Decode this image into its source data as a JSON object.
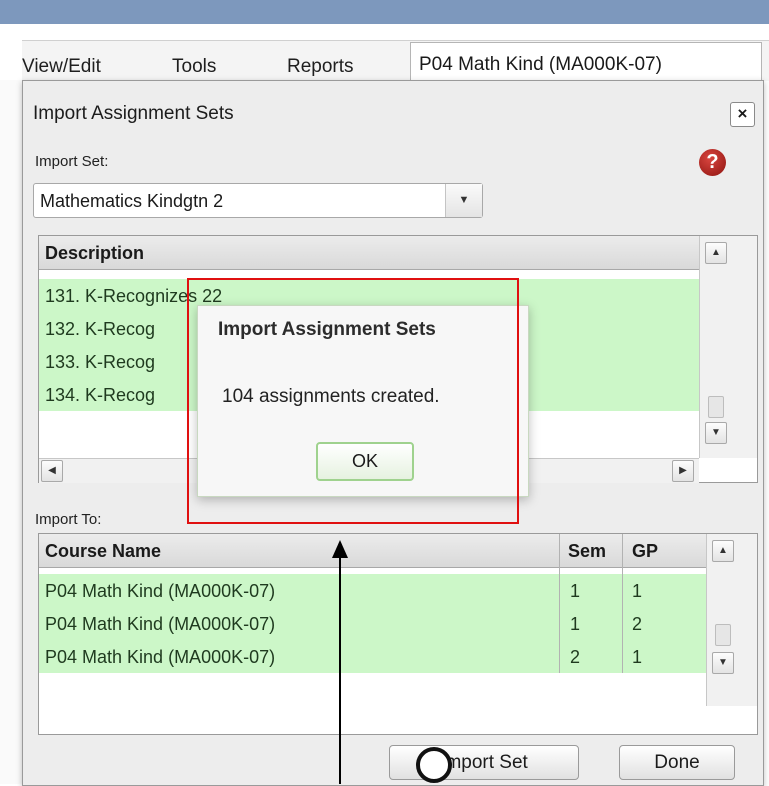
{
  "menubar": {
    "items": [
      "View/Edit",
      "Tools",
      "Reports"
    ],
    "course_tab": "P04   Math Kind (MA000K-07)"
  },
  "dialog": {
    "title": "Import Assignment Sets",
    "close_label": "×",
    "import_set_label": "Import Set:",
    "help_icon": "?",
    "import_set_value": "Mathematics Kindgtn 2",
    "description_header": "Description",
    "descriptions": [
      "131. K-Recognizes 22",
      "132. K-Recog",
      "133. K-Recog",
      "134. K-Recog"
    ],
    "import_to_label": "Import To:",
    "course_table": {
      "headers": [
        "Course Name",
        "Sem",
        "GP"
      ],
      "rows": [
        [
          "P04   Math Kind (MA000K-07)",
          "1",
          "1"
        ],
        [
          "P04   Math Kind (MA000K-07)",
          "1",
          "2"
        ],
        [
          "P04   Math Kind (MA000K-07)",
          "2",
          "1"
        ]
      ]
    },
    "import_button": "Import Set",
    "done_button": "Done"
  },
  "alert": {
    "title": "Import Assignment Sets",
    "message": "104 assignments created.",
    "ok": "OK"
  },
  "colors": {
    "row_green": "#ccf7c8",
    "annotation_red": "#e01010",
    "top_bar": "#7d98bd"
  }
}
